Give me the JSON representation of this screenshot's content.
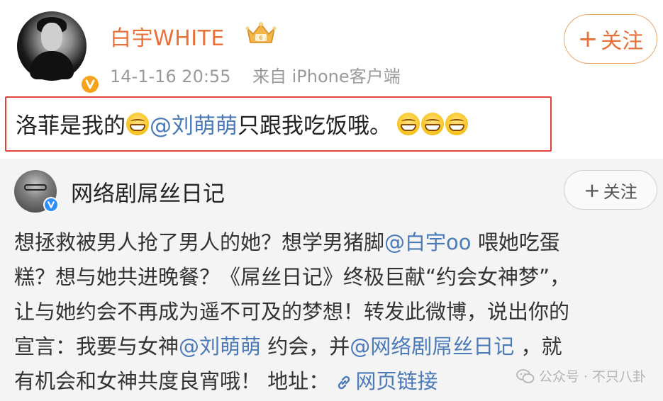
{
  "post": {
    "username": "白宇WHITE",
    "timestamp": "14-1-16 20:55",
    "source": "来自 iPhone客户端",
    "follow_plus": "+",
    "follow_label": "关注",
    "text_part1": "洛菲是我的",
    "mention": "@刘萌萌",
    "text_part2": " 只跟我吃饭哦。"
  },
  "repost": {
    "username": "网络剧屌丝日记",
    "follow_plus": "+",
    "follow_label": "关注",
    "line1_a": "想拯救被男人抢了男人的她？想学男猪脚",
    "line1_mention": "@白宇oo",
    "line1_b": " 喂她吃蛋",
    "line2": "糕？想与她共进晚餐？《屌丝日记》终极巨献“约会女神梦”，",
    "line3": "让与她约会不再成为遥不可及的梦想！转发此微博，说出你的",
    "line4_a": "宣言：我要与女神",
    "line4_mention1": "@刘萌萌",
    "line4_b": " 约会，并",
    "line4_mention2": "@网络剧屌丝日记",
    "line4_c": " ，就",
    "line5_a": "有机会和女神共度良宵哦！ 地址：",
    "line5_link": "网页链接"
  },
  "watermark": "公众号 · 不只八卦",
  "icons": {
    "verified_main": "verified-orange-badge-icon",
    "crown": "crown-member-icon",
    "emoji": "grin-emoji-icon",
    "verified_sub": "verified-blue-badge-icon",
    "link": "link-icon",
    "wechat": "wechat-icon"
  },
  "colors": {
    "username": "#e8703a",
    "mention": "#4a7ab8",
    "highlight_border": "#e0423a",
    "repost_bg": "#f4f4f4"
  }
}
